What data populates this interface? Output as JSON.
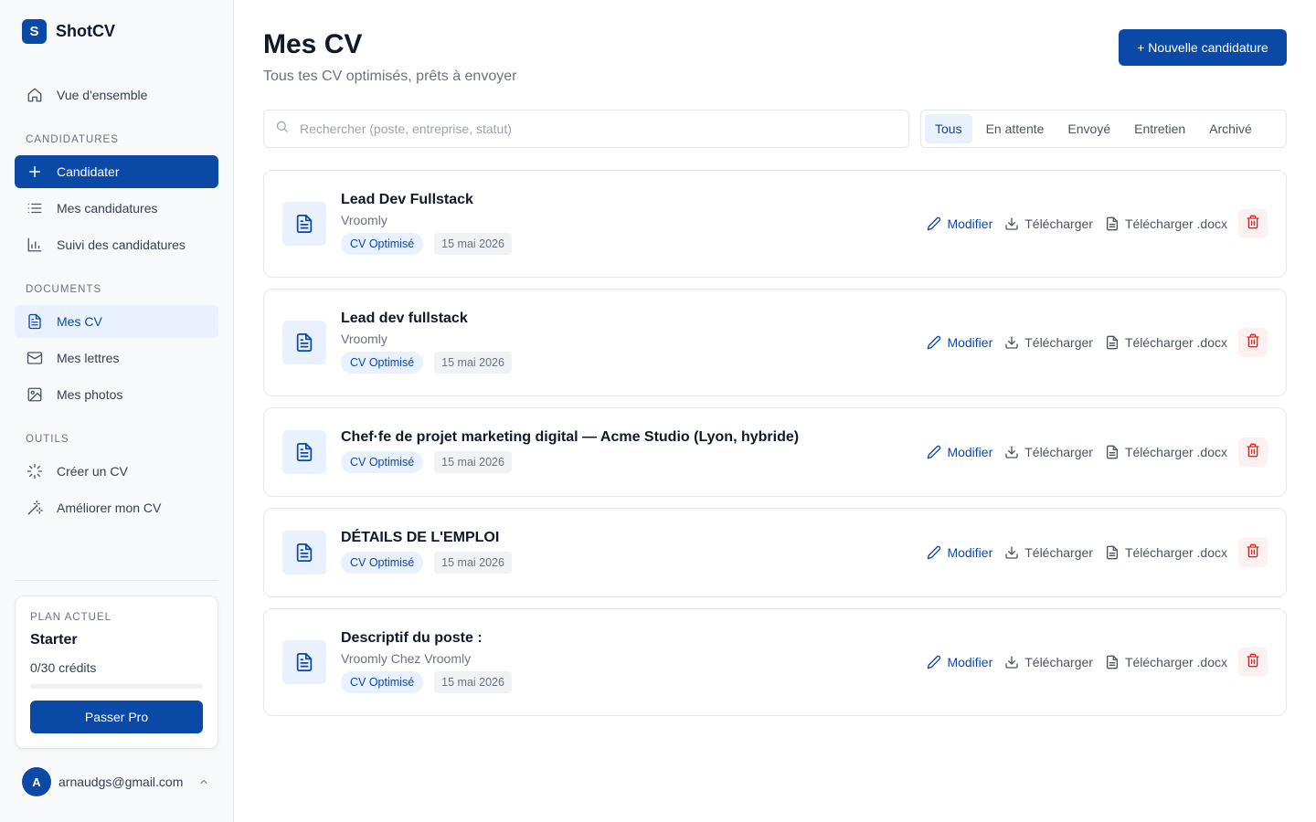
{
  "brand": {
    "logo_letter": "S",
    "name": "ShotCV"
  },
  "sidebar": {
    "overview": "Vue d'ensemble",
    "section_candidatures": "CANDIDATURES",
    "candidater": "Candidater",
    "mes_candidatures": "Mes candidatures",
    "suivi": "Suivi des candidatures",
    "section_documents": "DOCUMENTS",
    "mes_cv": "Mes CV",
    "mes_lettres": "Mes lettres",
    "mes_photos": "Mes photos",
    "section_outils": "OUTILS",
    "creer_cv": "Créer un CV",
    "ameliorer_cv": "Améliorer mon CV"
  },
  "plan": {
    "label": "PLAN ACTUEL",
    "name": "Starter",
    "credits": "0/30 crédits",
    "credits_progress": 0,
    "upgrade": "Passer Pro"
  },
  "user": {
    "initial": "A",
    "email": "arnaudgs@gmail.com"
  },
  "header": {
    "title": "Mes CV",
    "subtitle": "Tous tes CV optimisés, prêts à envoyer",
    "new_button": "+ Nouvelle candidature"
  },
  "search": {
    "placeholder": "Rechercher (poste, entreprise, statut)",
    "value": ""
  },
  "filters": {
    "all": "Tous",
    "pending": "En attente",
    "sent": "Envoyé",
    "interview": "Entretien",
    "archived": "Archivé",
    "active": "Tous"
  },
  "actions": {
    "edit": "Modifier",
    "download": "Télécharger",
    "download_docx": "Télécharger .docx"
  },
  "cvs": [
    {
      "title": "Lead Dev Fullstack",
      "company": "Vroomly",
      "status": "CV Optimisé",
      "date": "15 mai 2026"
    },
    {
      "title": "Lead dev fullstack",
      "company": "Vroomly",
      "status": "CV Optimisé",
      "date": "15 mai 2026"
    },
    {
      "title": "Chef·fe de projet marketing digital — Acme Studio (Lyon, hybride)",
      "company": "",
      "status": "CV Optimisé",
      "date": "15 mai 2026"
    },
    {
      "title": "DÉTAILS DE L'EMPLOI",
      "company": "",
      "status": "CV Optimisé",
      "date": "15 mai 2026"
    },
    {
      "title": "Descriptif du poste :",
      "company": "Vroomly Chez Vroomly",
      "status": "CV Optimisé",
      "date": "15 mai 2026"
    }
  ],
  "colors": {
    "accent": "#0b49a6",
    "accent_light": "#e8f1fd",
    "danger": "#dc2626",
    "danger_light": "#fdf0f0"
  }
}
